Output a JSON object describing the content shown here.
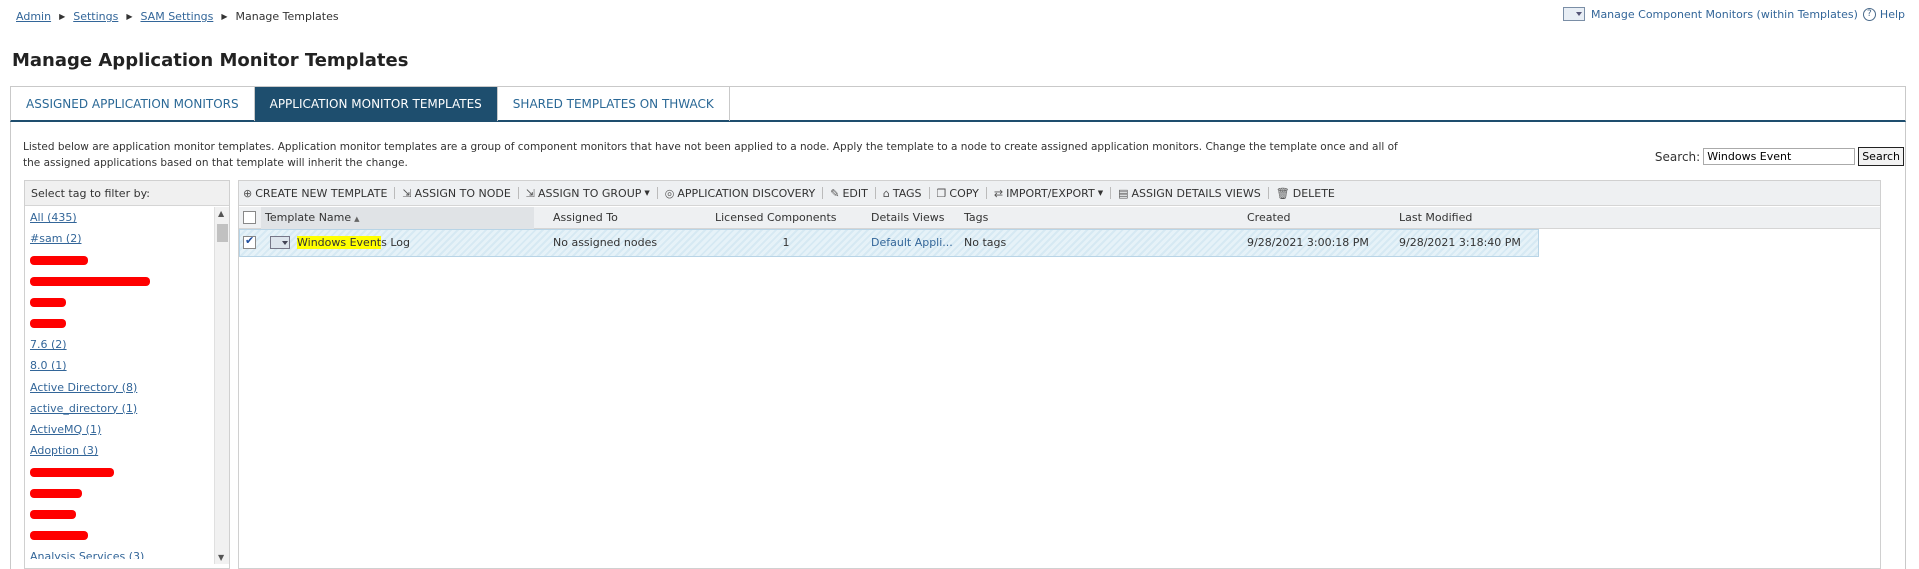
{
  "breadcrumb": {
    "items": [
      "Admin",
      "Settings",
      "SAM Settings"
    ],
    "current": "Manage Templates"
  },
  "top_links": {
    "manage_component_monitors": "Manage Component Monitors (within Templates)",
    "help": "Help"
  },
  "page": {
    "title": "Manage Application Monitor Templates"
  },
  "tabs": [
    {
      "label": "ASSIGNED APPLICATION MONITORS",
      "active": false
    },
    {
      "label": "APPLICATION MONITOR TEMPLATES",
      "active": true
    },
    {
      "label": "SHARED TEMPLATES ON THWACK",
      "active": false
    }
  ],
  "description": "Listed below are application monitor templates. Application monitor templates are a group of component monitors that have not been applied to a node. Apply the template to a node to create assigned application monitors. Change the template once and all of the assigned applications based on that template will inherit the change.",
  "search": {
    "label": "Search:",
    "value": "Windows Event",
    "button": "Search"
  },
  "tag_filter": {
    "header": "Select tag to filter by:",
    "items": [
      "All (435)",
      "#sam (2)",
      "",
      "",
      "",
      "",
      "7.6 (2)",
      "8.0 (1)",
      "Active Directory (8)",
      "active_directory (1)",
      "ActiveMQ (1)",
      "Adoption (3)",
      "",
      "",
      "",
      "",
      "Analysis Services (3)"
    ]
  },
  "toolbar": {
    "create": "CREATE NEW TEMPLATE",
    "assign_node": "ASSIGN TO NODE",
    "assign_group": "ASSIGN TO GROUP",
    "discovery": "APPLICATION DISCOVERY",
    "edit": "EDIT",
    "tags": "TAGS",
    "copy": "COPY",
    "import_export": "IMPORT/EXPORT",
    "assign_details": "ASSIGN DETAILS VIEWS",
    "delete": "DELETE"
  },
  "columns": {
    "name": "Template Name",
    "assigned": "Assigned To",
    "licensed": "Licensed Components",
    "details": "Details Views",
    "tags": "Tags",
    "created": "Created",
    "modified": "Last Modified"
  },
  "rows": [
    {
      "name_highlight": "Windows Event",
      "name_rest": "s Log",
      "assigned": "No assigned nodes",
      "licensed": "1",
      "details": "Default Appli...",
      "tags": "No tags",
      "created": "9/28/2021 3:00:18 PM",
      "modified": "9/28/2021 3:18:40 PM",
      "checked": true
    }
  ],
  "colors": {
    "accent": "#1e4e6e",
    "link": "#336699",
    "highlight": "#ffff00",
    "redaction": "#ff0000"
  }
}
